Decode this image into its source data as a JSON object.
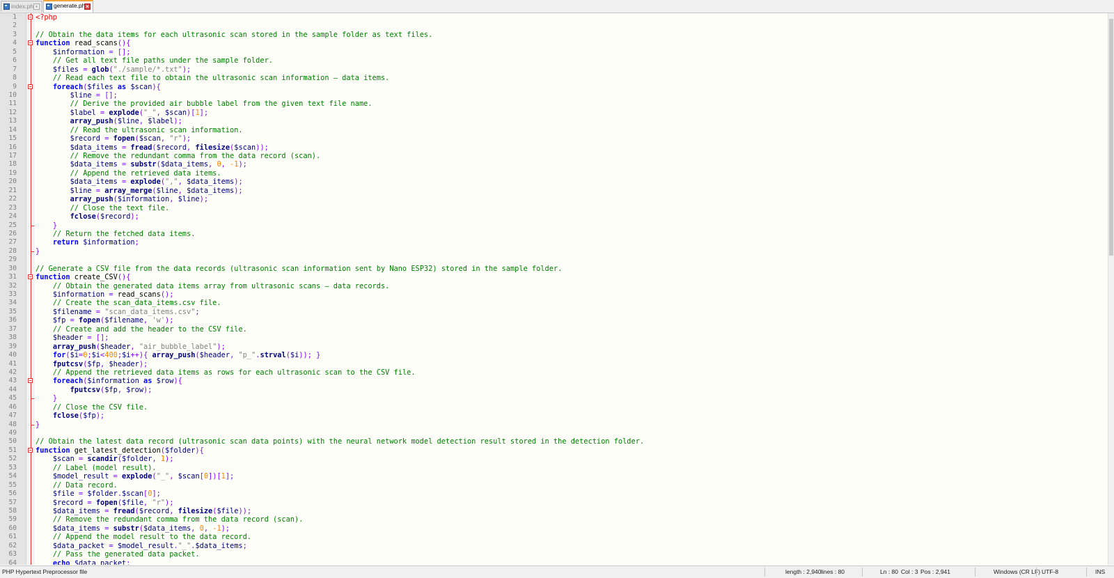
{
  "tabs": [
    {
      "label": "index.php",
      "active": false
    },
    {
      "label": "generate.php",
      "active": true
    }
  ],
  "editor": {
    "lines": [
      [
        [
          "t",
          "<?php"
        ]
      ],
      [],
      [
        [
          "c",
          "// Obtain the data items for each ultrasonic scan stored in the sample folder as text files."
        ]
      ],
      [
        [
          "k",
          "function"
        ],
        [
          "d",
          " read_scans"
        ],
        [
          "o",
          "(){"
        ]
      ],
      [
        [
          "d",
          "    "
        ],
        [
          "v",
          "$information"
        ],
        [
          "o",
          " = [];"
        ]
      ],
      [
        [
          "d",
          "    "
        ],
        [
          "c",
          "// Get all text file paths under the sample folder."
        ]
      ],
      [
        [
          "d",
          "    "
        ],
        [
          "v",
          "$files"
        ],
        [
          "o",
          " = "
        ],
        [
          "f",
          "glob"
        ],
        [
          "o",
          "("
        ],
        [
          "s",
          "\"./sample/*.txt\""
        ],
        [
          "o",
          ");"
        ]
      ],
      [
        [
          "d",
          "    "
        ],
        [
          "c",
          "// Read each text file to obtain the ultrasonic scan information — data items."
        ]
      ],
      [
        [
          "d",
          "    "
        ],
        [
          "k",
          "foreach"
        ],
        [
          "o",
          "("
        ],
        [
          "v",
          "$files"
        ],
        [
          "d",
          " "
        ],
        [
          "k",
          "as"
        ],
        [
          "d",
          " "
        ],
        [
          "v",
          "$scan"
        ],
        [
          "o",
          "){"
        ]
      ],
      [
        [
          "d",
          "        "
        ],
        [
          "v",
          "$line"
        ],
        [
          "o",
          " = [];"
        ]
      ],
      [
        [
          "d",
          "        "
        ],
        [
          "c",
          "// Derive the provided air bubble label from the given text file name."
        ]
      ],
      [
        [
          "d",
          "        "
        ],
        [
          "v",
          "$label"
        ],
        [
          "o",
          " = "
        ],
        [
          "f",
          "explode"
        ],
        [
          "o",
          "("
        ],
        [
          "s",
          "\"_\""
        ],
        [
          "o",
          ", "
        ],
        [
          "v",
          "$scan"
        ],
        [
          "o",
          ")["
        ],
        [
          "n",
          "1"
        ],
        [
          "o",
          "];"
        ]
      ],
      [
        [
          "d",
          "        "
        ],
        [
          "f",
          "array_push"
        ],
        [
          "o",
          "("
        ],
        [
          "v",
          "$line"
        ],
        [
          "o",
          ", "
        ],
        [
          "v",
          "$label"
        ],
        [
          "o",
          ");"
        ]
      ],
      [
        [
          "d",
          "        "
        ],
        [
          "c",
          "// Read the ultrasonic scan information."
        ]
      ],
      [
        [
          "d",
          "        "
        ],
        [
          "v",
          "$record"
        ],
        [
          "o",
          " = "
        ],
        [
          "f",
          "fopen"
        ],
        [
          "o",
          "("
        ],
        [
          "v",
          "$scan"
        ],
        [
          "o",
          ", "
        ],
        [
          "s",
          "\"r\""
        ],
        [
          "o",
          ");"
        ]
      ],
      [
        [
          "d",
          "        "
        ],
        [
          "v",
          "$data_items"
        ],
        [
          "o",
          " = "
        ],
        [
          "f",
          "fread"
        ],
        [
          "o",
          "("
        ],
        [
          "v",
          "$record"
        ],
        [
          "o",
          ", "
        ],
        [
          "f",
          "filesize"
        ],
        [
          "o",
          "("
        ],
        [
          "v",
          "$scan"
        ],
        [
          "o",
          "));"
        ]
      ],
      [
        [
          "d",
          "        "
        ],
        [
          "c",
          "// Remove the redundant comma from the data record (scan)."
        ]
      ],
      [
        [
          "d",
          "        "
        ],
        [
          "v",
          "$data_items"
        ],
        [
          "o",
          " = "
        ],
        [
          "f",
          "substr"
        ],
        [
          "o",
          "("
        ],
        [
          "v",
          "$data_items"
        ],
        [
          "o",
          ", "
        ],
        [
          "n",
          "0"
        ],
        [
          "o",
          ", "
        ],
        [
          "n",
          "-1"
        ],
        [
          "o",
          ");"
        ]
      ],
      [
        [
          "d",
          "        "
        ],
        [
          "c",
          "// Append the retrieved data items."
        ]
      ],
      [
        [
          "d",
          "        "
        ],
        [
          "v",
          "$data_items"
        ],
        [
          "o",
          " = "
        ],
        [
          "f",
          "explode"
        ],
        [
          "o",
          "("
        ],
        [
          "s",
          "\",\""
        ],
        [
          "o",
          ", "
        ],
        [
          "v",
          "$data_items"
        ],
        [
          "o",
          ");"
        ]
      ],
      [
        [
          "d",
          "        "
        ],
        [
          "v",
          "$line"
        ],
        [
          "o",
          " = "
        ],
        [
          "f",
          "array_merge"
        ],
        [
          "o",
          "("
        ],
        [
          "v",
          "$line"
        ],
        [
          "o",
          ", "
        ],
        [
          "v",
          "$data_items"
        ],
        [
          "o",
          ");"
        ]
      ],
      [
        [
          "d",
          "        "
        ],
        [
          "f",
          "array_push"
        ],
        [
          "o",
          "("
        ],
        [
          "v",
          "$information"
        ],
        [
          "o",
          ", "
        ],
        [
          "v",
          "$line"
        ],
        [
          "o",
          ");"
        ]
      ],
      [
        [
          "d",
          "        "
        ],
        [
          "c",
          "// Close the text file."
        ]
      ],
      [
        [
          "d",
          "        "
        ],
        [
          "f",
          "fclose"
        ],
        [
          "o",
          "("
        ],
        [
          "v",
          "$record"
        ],
        [
          "o",
          ");"
        ]
      ],
      [
        [
          "d",
          "    "
        ],
        [
          "o",
          "}"
        ]
      ],
      [
        [
          "d",
          "    "
        ],
        [
          "c",
          "// Return the fetched data items."
        ]
      ],
      [
        [
          "d",
          "    "
        ],
        [
          "k",
          "return"
        ],
        [
          "d",
          " "
        ],
        [
          "v",
          "$information"
        ],
        [
          "o",
          ";"
        ]
      ],
      [
        [
          "o",
          "}"
        ]
      ],
      [],
      [
        [
          "c",
          "// Generate a CSV file from the data records (ultrasonic scan information sent by Nano ESP32) stored in the sample folder."
        ]
      ],
      [
        [
          "k",
          "function"
        ],
        [
          "d",
          " create_CSV"
        ],
        [
          "o",
          "(){"
        ]
      ],
      [
        [
          "d",
          "    "
        ],
        [
          "c",
          "// Obtain the generated data items array from ultrasonic scans — data records."
        ]
      ],
      [
        [
          "d",
          "    "
        ],
        [
          "v",
          "$information"
        ],
        [
          "o",
          " = "
        ],
        [
          "d",
          "read_scans"
        ],
        [
          "o",
          "();"
        ]
      ],
      [
        [
          "d",
          "    "
        ],
        [
          "c",
          "// Create the scan_data_items.csv file."
        ]
      ],
      [
        [
          "d",
          "    "
        ],
        [
          "v",
          "$filename"
        ],
        [
          "o",
          " = "
        ],
        [
          "s",
          "\"scan_data_items.csv\""
        ],
        [
          "o",
          ";"
        ]
      ],
      [
        [
          "d",
          "    "
        ],
        [
          "v",
          "$fp"
        ],
        [
          "o",
          " = "
        ],
        [
          "f",
          "fopen"
        ],
        [
          "o",
          "("
        ],
        [
          "v",
          "$filename"
        ],
        [
          "o",
          ", "
        ],
        [
          "s",
          "'w'"
        ],
        [
          "o",
          ");"
        ]
      ],
      [
        [
          "d",
          "    "
        ],
        [
          "c",
          "// Create and add the header to the CSV file."
        ]
      ],
      [
        [
          "d",
          "    "
        ],
        [
          "v",
          "$header"
        ],
        [
          "o",
          " = [];"
        ]
      ],
      [
        [
          "d",
          "    "
        ],
        [
          "f",
          "array_push"
        ],
        [
          "o",
          "("
        ],
        [
          "v",
          "$header"
        ],
        [
          "o",
          ", "
        ],
        [
          "s",
          "\"air_bubble_label\""
        ],
        [
          "o",
          ");"
        ]
      ],
      [
        [
          "d",
          "    "
        ],
        [
          "k",
          "for"
        ],
        [
          "o",
          "("
        ],
        [
          "v",
          "$i"
        ],
        [
          "o",
          "="
        ],
        [
          "n",
          "0"
        ],
        [
          "o",
          ";"
        ],
        [
          "v",
          "$i"
        ],
        [
          "o",
          "<"
        ],
        [
          "n",
          "400"
        ],
        [
          "o",
          ";"
        ],
        [
          "v",
          "$i"
        ],
        [
          "o",
          "++){ "
        ],
        [
          "f",
          "array_push"
        ],
        [
          "o",
          "("
        ],
        [
          "v",
          "$header"
        ],
        [
          "o",
          ", "
        ],
        [
          "s",
          "\"p_\""
        ],
        [
          "o",
          "."
        ],
        [
          "f",
          "strval"
        ],
        [
          "o",
          "("
        ],
        [
          "v",
          "$i"
        ],
        [
          "o",
          "));"
        ],
        [
          "d",
          " "
        ],
        [
          "o",
          "}"
        ]
      ],
      [
        [
          "d",
          "    "
        ],
        [
          "f",
          "fputcsv"
        ],
        [
          "o",
          "("
        ],
        [
          "v",
          "$fp"
        ],
        [
          "o",
          ", "
        ],
        [
          "v",
          "$header"
        ],
        [
          "o",
          ");"
        ]
      ],
      [
        [
          "d",
          "    "
        ],
        [
          "c",
          "// Append the retrieved data items as rows for each ultrasonic scan to the CSV file."
        ]
      ],
      [
        [
          "d",
          "    "
        ],
        [
          "k",
          "foreach"
        ],
        [
          "o",
          "("
        ],
        [
          "v",
          "$information"
        ],
        [
          "d",
          " "
        ],
        [
          "k",
          "as"
        ],
        [
          "d",
          " "
        ],
        [
          "v",
          "$row"
        ],
        [
          "o",
          "){"
        ]
      ],
      [
        [
          "d",
          "        "
        ],
        [
          "f",
          "fputcsv"
        ],
        [
          "o",
          "("
        ],
        [
          "v",
          "$fp"
        ],
        [
          "o",
          ", "
        ],
        [
          "v",
          "$row"
        ],
        [
          "o",
          ");"
        ]
      ],
      [
        [
          "d",
          "    "
        ],
        [
          "o",
          "}"
        ]
      ],
      [
        [
          "d",
          "    "
        ],
        [
          "c",
          "// Close the CSV file."
        ]
      ],
      [
        [
          "d",
          "    "
        ],
        [
          "f",
          "fclose"
        ],
        [
          "o",
          "("
        ],
        [
          "v",
          "$fp"
        ],
        [
          "o",
          ");"
        ]
      ],
      [
        [
          "o",
          "}"
        ]
      ],
      [],
      [
        [
          "c",
          "// Obtain the latest data record (ultrasonic scan data points) with the neural network model detection result stored in the detection folder."
        ]
      ],
      [
        [
          "k",
          "function"
        ],
        [
          "d",
          " get_latest_detection"
        ],
        [
          "o",
          "("
        ],
        [
          "v",
          "$folder"
        ],
        [
          "o",
          "){"
        ]
      ],
      [
        [
          "d",
          "    "
        ],
        [
          "v",
          "$scan"
        ],
        [
          "o",
          " = "
        ],
        [
          "f",
          "scandir"
        ],
        [
          "o",
          "("
        ],
        [
          "v",
          "$folder"
        ],
        [
          "o",
          ", "
        ],
        [
          "n",
          "1"
        ],
        [
          "o",
          ");"
        ]
      ],
      [
        [
          "d",
          "    "
        ],
        [
          "c",
          "// Label (model result)."
        ]
      ],
      [
        [
          "d",
          "    "
        ],
        [
          "v",
          "$model_result"
        ],
        [
          "o",
          " = "
        ],
        [
          "f",
          "explode"
        ],
        [
          "o",
          "("
        ],
        [
          "s",
          "\"_\""
        ],
        [
          "o",
          ", "
        ],
        [
          "v",
          "$scan"
        ],
        [
          "o",
          "["
        ],
        [
          "n",
          "0"
        ],
        [
          "o",
          "])["
        ],
        [
          "n",
          "1"
        ],
        [
          "o",
          "];"
        ]
      ],
      [
        [
          "d",
          "    "
        ],
        [
          "c",
          "// Data record."
        ]
      ],
      [
        [
          "d",
          "    "
        ],
        [
          "v",
          "$file"
        ],
        [
          "o",
          " = "
        ],
        [
          "v",
          "$folder"
        ],
        [
          "o",
          "."
        ],
        [
          "v",
          "$scan"
        ],
        [
          "o",
          "["
        ],
        [
          "n",
          "0"
        ],
        [
          "o",
          "];"
        ]
      ],
      [
        [
          "d",
          "    "
        ],
        [
          "v",
          "$record"
        ],
        [
          "o",
          " = "
        ],
        [
          "f",
          "fopen"
        ],
        [
          "o",
          "("
        ],
        [
          "v",
          "$file"
        ],
        [
          "o",
          ", "
        ],
        [
          "s",
          "\"r\""
        ],
        [
          "o",
          ");"
        ]
      ],
      [
        [
          "d",
          "    "
        ],
        [
          "v",
          "$data_items"
        ],
        [
          "o",
          " = "
        ],
        [
          "f",
          "fread"
        ],
        [
          "o",
          "("
        ],
        [
          "v",
          "$record"
        ],
        [
          "o",
          ", "
        ],
        [
          "f",
          "filesize"
        ],
        [
          "o",
          "("
        ],
        [
          "v",
          "$file"
        ],
        [
          "o",
          "));"
        ]
      ],
      [
        [
          "d",
          "    "
        ],
        [
          "c",
          "// Remove the redundant comma from the data record (scan)."
        ]
      ],
      [
        [
          "d",
          "    "
        ],
        [
          "v",
          "$data_items"
        ],
        [
          "o",
          " = "
        ],
        [
          "f",
          "substr"
        ],
        [
          "o",
          "("
        ],
        [
          "v",
          "$data_items"
        ],
        [
          "o",
          ", "
        ],
        [
          "n",
          "0"
        ],
        [
          "o",
          ", "
        ],
        [
          "n",
          "-1"
        ],
        [
          "o",
          ");"
        ]
      ],
      [
        [
          "d",
          "    "
        ],
        [
          "c",
          "// Append the model result to the data record."
        ]
      ],
      [
        [
          "d",
          "    "
        ],
        [
          "v",
          "$data_packet"
        ],
        [
          "o",
          " = "
        ],
        [
          "v",
          "$model_result"
        ],
        [
          "o",
          "."
        ],
        [
          "s",
          "\"_\""
        ],
        [
          "o",
          "."
        ],
        [
          "v",
          "$data_items"
        ],
        [
          "o",
          ";"
        ]
      ],
      [
        [
          "d",
          "    "
        ],
        [
          "c",
          "// Pass the generated data packet."
        ]
      ],
      [
        [
          "d",
          "    "
        ],
        [
          "k",
          "echo"
        ],
        [
          "d",
          " "
        ],
        [
          "v",
          "$data_packet"
        ],
        [
          "o",
          ";"
        ]
      ]
    ],
    "fold_open": [
      1,
      4,
      9,
      31,
      43,
      51
    ],
    "fold_close": [
      25,
      28,
      45,
      48
    ]
  },
  "statusbar": {
    "language": "PHP Hypertext Preprocessor file",
    "length": "length : 2,940",
    "lines": "lines : 80",
    "ln": "Ln : 80",
    "col": "Col : 3",
    "pos": "Pos : 2,941",
    "eol": "Windows (CR LF)",
    "encoding": "UTF-8",
    "mode": "INS"
  }
}
